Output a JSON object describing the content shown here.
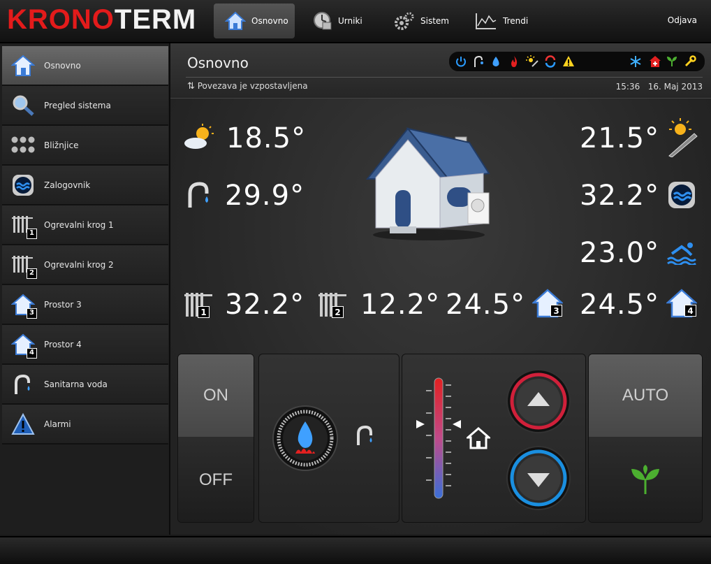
{
  "brand": {
    "part1": "KRONO",
    "part2": "TERM"
  },
  "nav": {
    "tabs": [
      {
        "label": "Osnovno",
        "icon": "home-icon"
      },
      {
        "label": "Urniki",
        "icon": "clock-icon"
      },
      {
        "label": "Sistem",
        "icon": "gears-icon"
      },
      {
        "label": "Trendi",
        "icon": "chart-icon"
      }
    ],
    "logout": "Odjava"
  },
  "sidebar": {
    "items": [
      {
        "label": "Osnovno",
        "icon": "home-icon"
      },
      {
        "label": "Pregled sistema",
        "icon": "magnifier-icon"
      },
      {
        "label": "Bližnjice",
        "icon": "dots-grid-icon"
      },
      {
        "label": "Zalogovnik",
        "icon": "water-tank-icon"
      },
      {
        "label": "Ogrevalni krog 1",
        "icon": "radiator-icon",
        "badge": "1"
      },
      {
        "label": "Ogrevalni krog 2",
        "icon": "radiator-icon",
        "badge": "2"
      },
      {
        "label": "Prostor 3",
        "icon": "home-icon",
        "badge": "3"
      },
      {
        "label": "Prostor 4",
        "icon": "home-icon",
        "badge": "4"
      },
      {
        "label": "Sanitarna voda",
        "icon": "faucet-icon"
      },
      {
        "label": "Alarmi",
        "icon": "warning-icon"
      }
    ]
  },
  "header": {
    "title": "Osnovno",
    "connection": "Povezava je vzpostavljena",
    "time": "15:36",
    "date": "16. Maj 2013"
  },
  "status_icons": [
    "power-icon",
    "faucet-icon",
    "drop-icon",
    "flame-icon",
    "sun-icon",
    "cycle-icon",
    "warning-icon",
    "snowflake-icon",
    "first-aid-icon",
    "leaf-icon",
    "wrench-icon"
  ],
  "readings": {
    "outdoor": "18.5°",
    "sanitary": "29.9°",
    "solar": "21.5°",
    "tank": "32.2°",
    "pool": "23.0°",
    "circuit1": "32.2°",
    "circuit2": "12.2°",
    "room3": "24.5°",
    "room4": "24.5°"
  },
  "badges": {
    "c1": "1",
    "c2": "2",
    "r3": "3",
    "r4": "4"
  },
  "controls": {
    "on_label": "ON",
    "off_label": "OFF",
    "auto_label": "AUTO"
  },
  "colors": {
    "brand_red": "#e31b1b",
    "up_ring": "#d0203a",
    "down_ring": "#1a8fe0"
  }
}
